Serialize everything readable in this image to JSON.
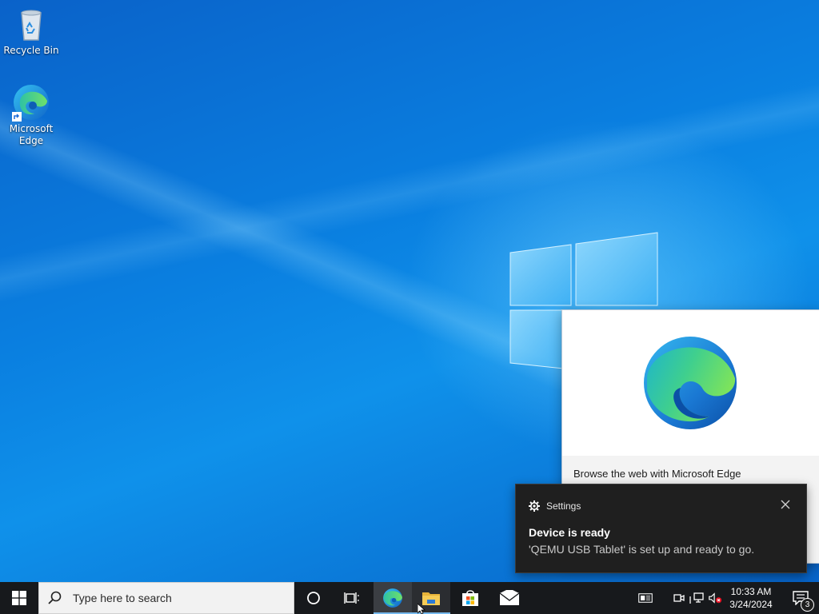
{
  "desktop": {
    "icons": [
      {
        "label": "Recycle Bin",
        "icon": "recycle-bin-icon"
      },
      {
        "label": "Microsoft Edge",
        "icon": "edge-icon"
      }
    ]
  },
  "edge_card": {
    "text": "Browse the web with Microsoft Edge",
    "icon": "edge-logo-icon"
  },
  "toast": {
    "app": "Settings",
    "title": "Device is ready",
    "body": "'QEMU USB Tablet' is set up and ready to go.",
    "icon": "gear-icon"
  },
  "taskbar": {
    "search_placeholder": "Type here to search",
    "pinned": [
      {
        "name": "Microsoft Edge",
        "icon": "edge-icon"
      },
      {
        "name": "File Explorer",
        "icon": "folder-icon"
      },
      {
        "name": "Microsoft Store",
        "icon": "store-icon"
      },
      {
        "name": "Mail",
        "icon": "mail-icon"
      }
    ],
    "clock": {
      "time": "10:33 AM",
      "date": "3/24/2024"
    },
    "notification_count": "3"
  },
  "colors": {
    "accent": "#0078d7",
    "taskbar_bg": "#17191c",
    "toast_bg": "#1f1f1f"
  }
}
